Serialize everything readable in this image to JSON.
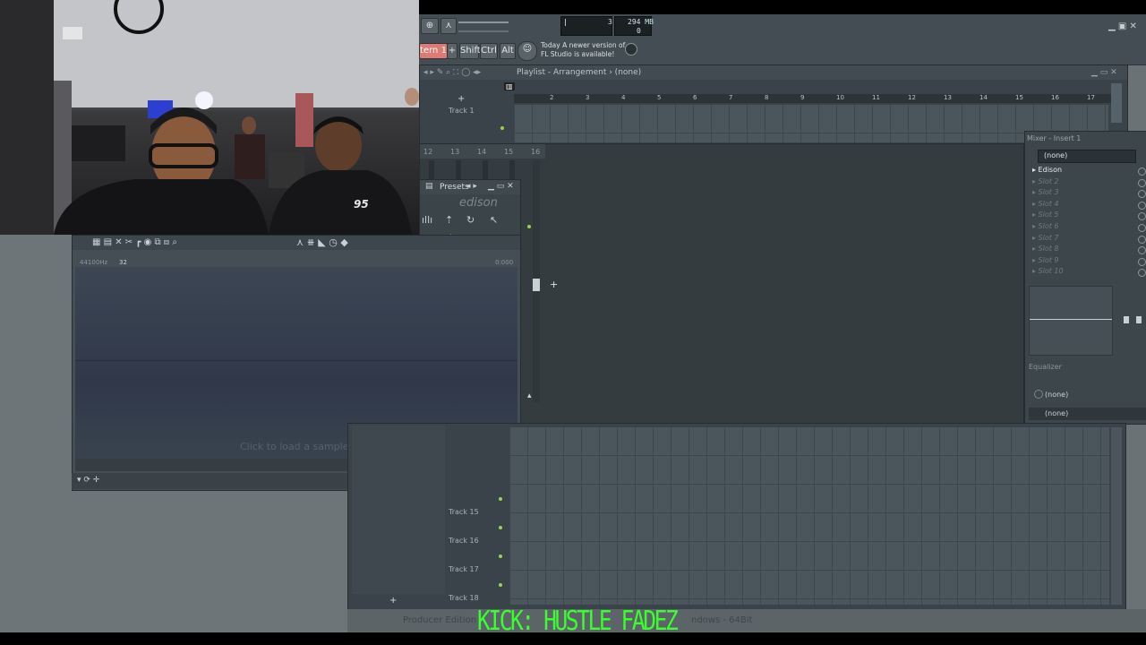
{
  "toolbar": {
    "pattern_label": "tern 1",
    "shift_label": "Shift",
    "ctrl_label": "Ctrl",
    "alt_label": "Alt",
    "hint_line1": "Today  A newer version of",
    "hint_line2": "FL Studio is available!",
    "cpu_value": "3",
    "memory_value": "294 MB",
    "poly_value": "0"
  },
  "playlist": {
    "title": "Playlist - Arrangement › (none)",
    "track_top": "Track 1",
    "ruler_numbers": [
      "2",
      "3",
      "4",
      "5",
      "6",
      "7",
      "8",
      "9",
      "10",
      "11",
      "12",
      "13",
      "14",
      "15",
      "16",
      "17"
    ],
    "lower_tracks": [
      "Track 15",
      "Track 16",
      "Track 17",
      "Track 18"
    ],
    "channel_numbers": [
      "12",
      "13",
      "14",
      "15",
      "16"
    ]
  },
  "presets": {
    "title": "Presets",
    "logo": "edison"
  },
  "edison": {
    "info_labels": [
      "44100Hz",
      "32"
    ],
    "time": "0:000",
    "placeholder": "Click to load a sample"
  },
  "mixer": {
    "title": "Mixer - Insert 1",
    "top_select": "(none)",
    "slots": [
      "Edison",
      "Slot 2",
      "Slot 3",
      "Slot 4",
      "Slot 5",
      "Slot 6",
      "Slot 7",
      "Slot 8",
      "Slot 9",
      "Slot 10"
    ],
    "eq_label": "Equalizer",
    "send1": "(none)",
    "send2": "(none)"
  },
  "status": {
    "left_text": "Producer Edition",
    "right_text": "ndows - 64Bit"
  },
  "overlay": {
    "caption": "KICK: HUSTLE FADEZ",
    "caption_color": "#39ff2e"
  },
  "webcam": {
    "shirt_text": "95"
  }
}
